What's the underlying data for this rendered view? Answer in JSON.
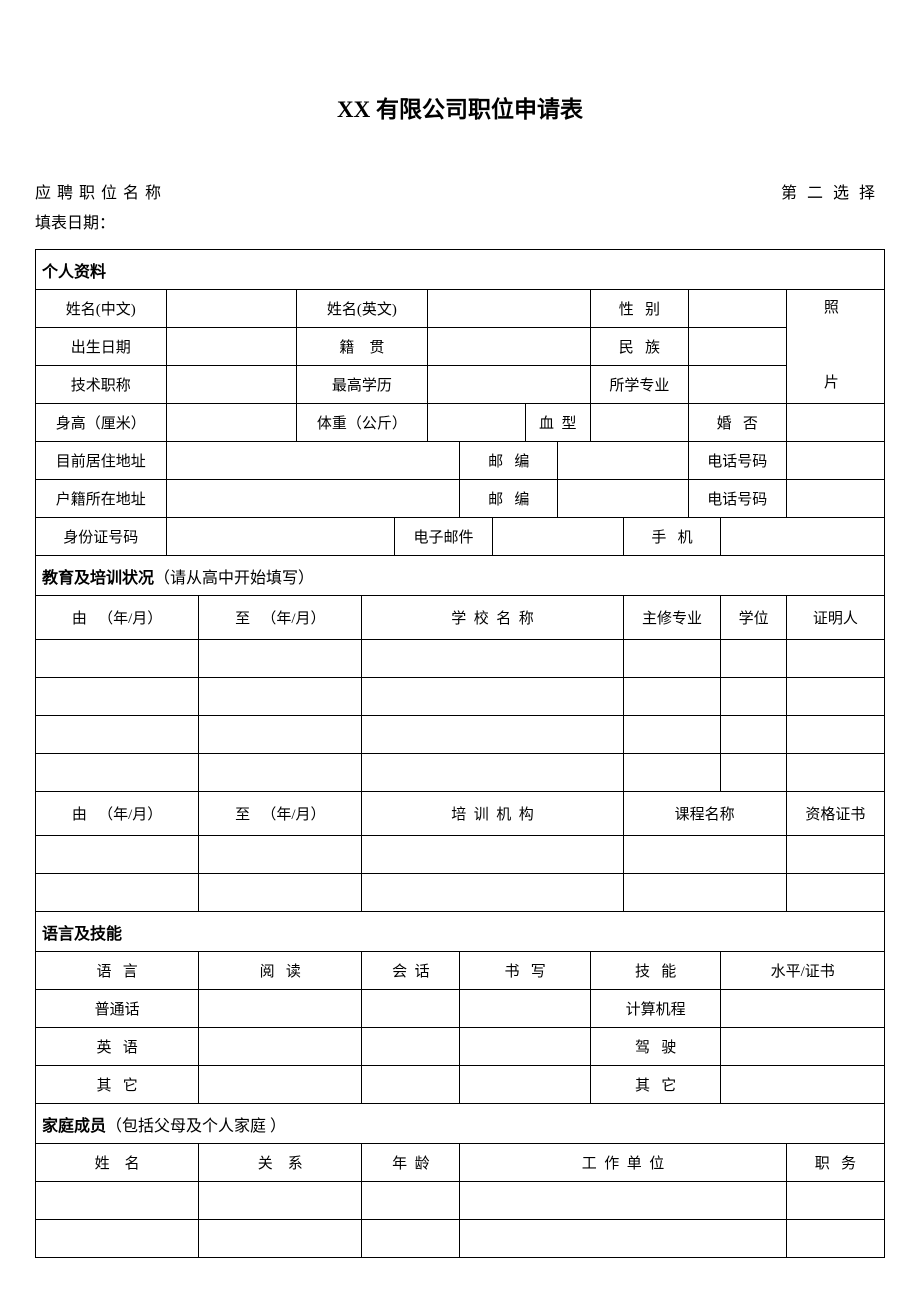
{
  "title": "XX 有限公司职位申请表",
  "header": {
    "position": "应聘职位名称",
    "second_choice": "第二选择",
    "form_date": "填表日期："
  },
  "personal": {
    "section": "个人资料",
    "name_cn": "姓名(中文)",
    "name_en": "姓名(英文)",
    "gender_1": "性",
    "gender_2": "别",
    "photo_1": "照",
    "photo_2": "片",
    "birth": "出生日期",
    "origin_1": "籍",
    "origin_2": "贯",
    "ethnicity_1": "民",
    "ethnicity_2": "族",
    "title_tech": "技术职称",
    "education": "最高学历",
    "major": "所学专业",
    "height": "身高（厘米）",
    "weight": "体重（公斤）",
    "blood_1": "血",
    "blood_2": "型",
    "marital_1": "婚",
    "marital_2": "否",
    "current_addr": "目前居住地址",
    "postcode_1": "邮",
    "postcode_2": "编",
    "phone": "电话号码",
    "hukou_addr": "户籍所在地址",
    "id_number": "身份证号码",
    "email": "电子邮件",
    "mobile_1": "手",
    "mobile_2": "机"
  },
  "edu": {
    "section": "教育及培训状况",
    "section_sub": "（请从高中开始填写）",
    "from_1": "由",
    "from_2": "（年/月）",
    "to_1": "至",
    "to_2": "（年/月）",
    "school_1": "学",
    "school_2": "校",
    "school_3": "名",
    "school_4": "称",
    "major": "主修专业",
    "degree": "学位",
    "reference": "证明人",
    "org_1": "培",
    "org_2": "训",
    "org_3": "机",
    "org_4": "构",
    "course": "课程名称",
    "cert": "资格证书"
  },
  "lang": {
    "section": "语言及技能",
    "language_1": "语",
    "language_2": "言",
    "read_1": "阅",
    "read_2": "读",
    "speak_1": "会",
    "speak_2": "话",
    "write_1": "书",
    "write_2": "写",
    "skill_1": "技",
    "skill_2": "能",
    "level": "水平/证书",
    "mandarin": "普通话",
    "english_1": "英",
    "english_2": "语",
    "other_1": "其",
    "other_2": "它",
    "computer": "计算机程",
    "driving_1": "驾",
    "driving_2": "驶"
  },
  "family": {
    "section": "家庭成员",
    "section_sub": "（包括父母及个人家庭 ）",
    "name_1": "姓",
    "name_2": "名",
    "relation_1": "关",
    "relation_2": "系",
    "age_1": "年",
    "age_2": "龄",
    "work_1": "工",
    "work_2": "作",
    "work_3": "单",
    "work_4": "位",
    "position_1": "职",
    "position_2": "务"
  }
}
